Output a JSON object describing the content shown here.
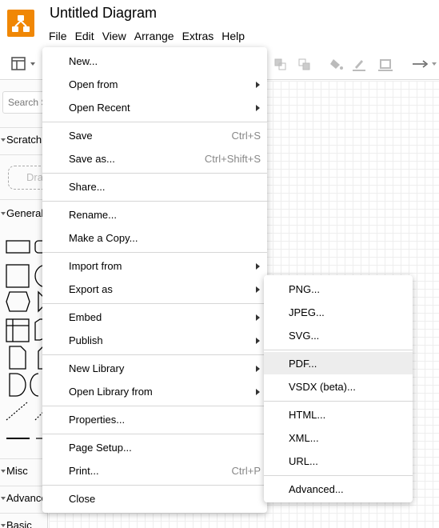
{
  "app": {
    "title": "Untitled Diagram",
    "brand_color": "#f08705",
    "logo_icon": "drawio-logo-icon"
  },
  "menubar": [
    "File",
    "Edit",
    "View",
    "Arrange",
    "Extras",
    "Help"
  ],
  "sidebar": {
    "search_placeholder": "Search Shapes",
    "scratchpad_label": "Scratchpad",
    "drag_text": "Drag elements here",
    "general_label": "General",
    "misc_label": "Misc",
    "advanced_label": "Advanced",
    "basic_label": "Basic"
  },
  "file_menu": {
    "items": [
      {
        "label": "New...",
        "shortcut": "",
        "submenu": false
      },
      {
        "label": "Open from",
        "shortcut": "",
        "submenu": true
      },
      {
        "label": "Open Recent",
        "shortcut": "",
        "submenu": true
      },
      {
        "label": "Save",
        "shortcut": "Ctrl+S",
        "submenu": false
      },
      {
        "label": "Save as...",
        "shortcut": "Ctrl+Shift+S",
        "submenu": false
      },
      {
        "label": "Share...",
        "shortcut": "",
        "submenu": false
      },
      {
        "label": "Rename...",
        "shortcut": "",
        "submenu": false
      },
      {
        "label": "Make a Copy...",
        "shortcut": "",
        "submenu": false
      },
      {
        "label": "Import from",
        "shortcut": "",
        "submenu": true
      },
      {
        "label": "Export as",
        "shortcut": "",
        "submenu": true
      },
      {
        "label": "Embed",
        "shortcut": "",
        "submenu": true
      },
      {
        "label": "Publish",
        "shortcut": "",
        "submenu": true
      },
      {
        "label": "New Library",
        "shortcut": "",
        "submenu": true
      },
      {
        "label": "Open Library from",
        "shortcut": "",
        "submenu": true
      },
      {
        "label": "Properties...",
        "shortcut": "",
        "submenu": false
      },
      {
        "label": "Page Setup...",
        "shortcut": "",
        "submenu": false
      },
      {
        "label": "Print...",
        "shortcut": "Ctrl+P",
        "submenu": false
      },
      {
        "label": "Close",
        "shortcut": "",
        "submenu": false
      }
    ]
  },
  "export_menu": {
    "items": [
      {
        "label": "PNG..."
      },
      {
        "label": "JPEG..."
      },
      {
        "label": "SVG..."
      },
      {
        "label": "PDF..."
      },
      {
        "label": "VSDX (beta)..."
      },
      {
        "label": "HTML..."
      },
      {
        "label": "XML..."
      },
      {
        "label": "URL..."
      },
      {
        "label": "Advanced..."
      }
    ],
    "highlighted": "PDF..."
  }
}
